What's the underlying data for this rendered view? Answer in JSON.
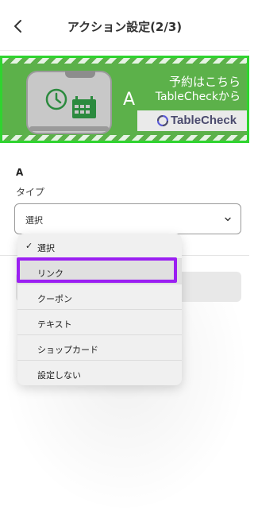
{
  "header": {
    "title": "アクション設定(2/3)",
    "back_icon": "chevron-left-icon"
  },
  "banner": {
    "letter": "A",
    "text_line1": "予約はこちら",
    "text_line2": "TableCheckから",
    "logo_text": "TableCheck",
    "colors": {
      "background": "#5cb14a",
      "border": "#2fd42f",
      "icon": "#2b8a3e",
      "logo": "#4b4b6e"
    }
  },
  "form": {
    "section_label": "A",
    "type_label": "タイプ",
    "select_value": "選択"
  },
  "dropdown": {
    "options": [
      "選択",
      "リンク",
      "クーポン",
      "テキスト",
      "ショップカード",
      "設定しない"
    ],
    "checked_index": 0,
    "highlighted_index": 1,
    "check_mark": "✓",
    "highlight_color": "#9b1ff2"
  }
}
